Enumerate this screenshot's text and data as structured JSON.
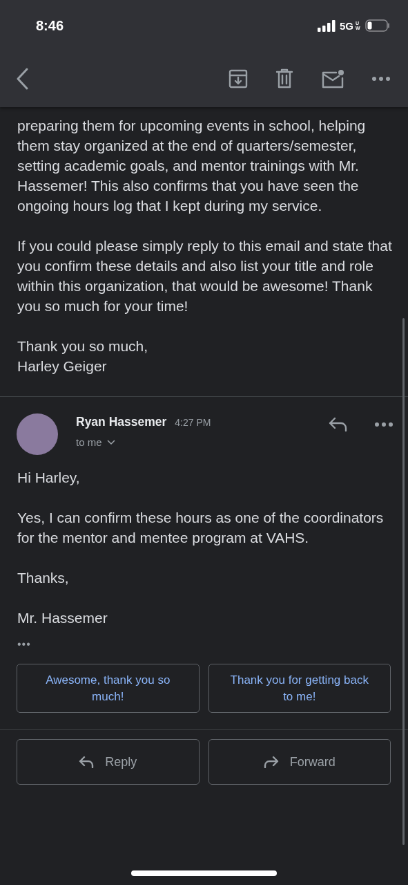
{
  "status_bar": {
    "time": "8:46",
    "network": "5G",
    "network_sub": "UW"
  },
  "thread": [
    {
      "kind": "quoted",
      "paragraphs": [
        "preparing them for upcoming events in school, helping them stay organized at the end of quarters/semester, setting academic goals, and mentor trainings with Mr. Hassemer! This also confirms that you have seen the ongoing hours log that I kept during my service.",
        "If you could please simply reply to this email and state that you confirm these details and also list your title and role within this organization, that would be awesome! Thank you so much for your time!",
        "Thank you so much,\nHarley Geiger"
      ]
    },
    {
      "kind": "message",
      "sender": "Ryan Hassemer",
      "time": "4:27 PM",
      "recipient": "to me",
      "paragraphs": [
        "Hi Harley,",
        "Yes, I can confirm these hours as one of the coordinators for the mentor and mentee program at VAHS.",
        "Thanks,",
        "Mr. Hassemer"
      ],
      "trimmed": "•••"
    }
  ],
  "smart_replies": [
    "Awesome, thank you so much!",
    "Thank you for getting back to me!"
  ],
  "actions": [
    {
      "kind": "reply",
      "label": "Reply"
    },
    {
      "kind": "forward",
      "label": "Forward"
    }
  ]
}
